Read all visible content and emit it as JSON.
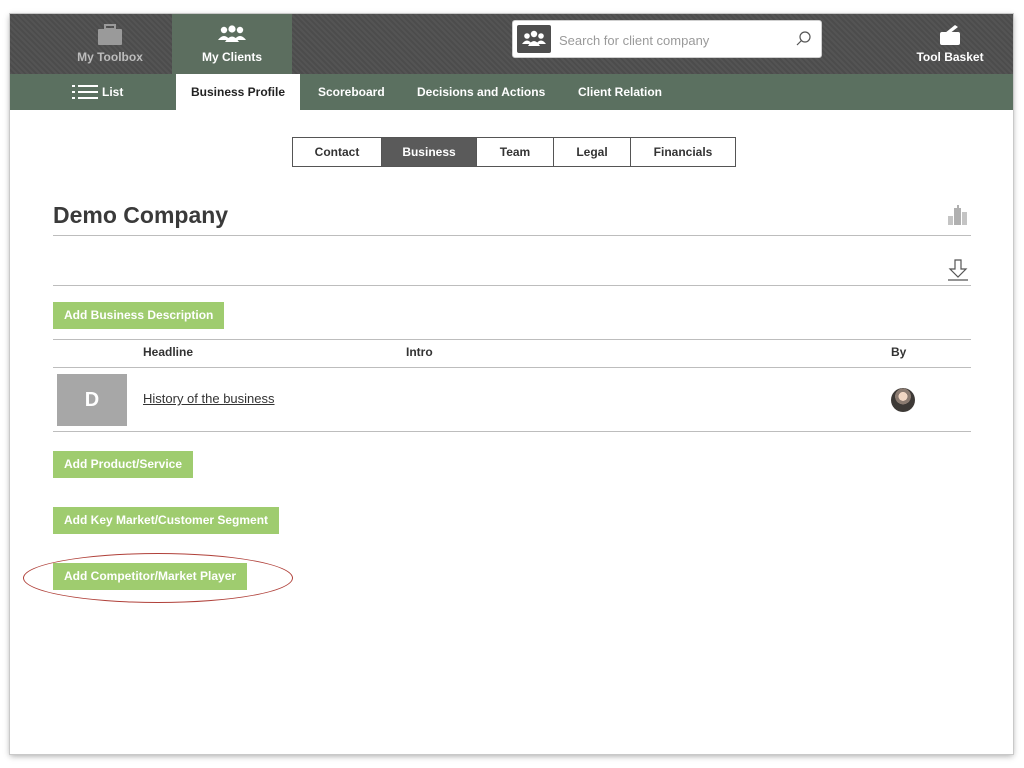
{
  "topbar": {
    "toolbox_label": "My Toolbox",
    "clients_label": "My Clients",
    "basket_label": "Tool Basket",
    "search_placeholder": "Search for client company"
  },
  "nav": {
    "list_label": "List",
    "tabs": [
      {
        "label": "Business Profile",
        "active": true
      },
      {
        "label": "Scoreboard"
      },
      {
        "label": "Decisions and Actions"
      },
      {
        "label": "Client Relation"
      }
    ]
  },
  "subtabs": [
    {
      "label": "Contact"
    },
    {
      "label": "Business",
      "active": true
    },
    {
      "label": "Team"
    },
    {
      "label": "Legal"
    },
    {
      "label": "Financials"
    }
  ],
  "company": {
    "name": "Demo Company"
  },
  "buttons": {
    "add_description": "Add Business Description",
    "add_product": "Add Product/Service",
    "add_market": "Add Key Market/Customer Segment",
    "add_competitor": "Add Competitor/Market Player"
  },
  "table": {
    "headers": {
      "headline": "Headline",
      "intro": "Intro",
      "by": "By"
    },
    "rows": [
      {
        "initial": "D",
        "headline": "History of the business",
        "intro": ""
      }
    ]
  },
  "colors": {
    "topbar": "#4e4e4e",
    "navbar": "#5b7060",
    "accent_green": "#9fcc6f",
    "annotation": "#b0413a"
  }
}
